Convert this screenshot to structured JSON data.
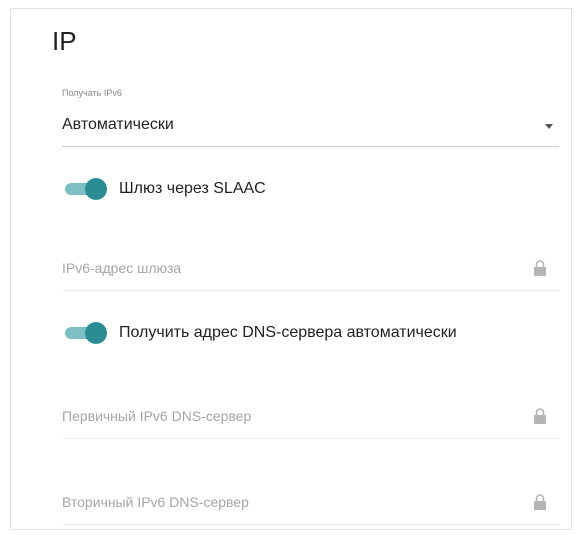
{
  "section": {
    "title": "IP"
  },
  "ipv6_mode": {
    "label": "Получать IPv6",
    "value": "Автоматически"
  },
  "slaac_toggle": {
    "label": "Шлюз через SLAAC",
    "enabled": true
  },
  "gateway_field": {
    "placeholder": "IPv6-адрес шлюза",
    "icon": "lock-icon"
  },
  "dns_auto_toggle": {
    "label": "Получить адрес DNS-сервера автоматически",
    "enabled": true
  },
  "primary_dns_field": {
    "placeholder": "Первичный IPv6 DNS-сервер",
    "icon": "lock-icon"
  },
  "secondary_dns_field": {
    "placeholder": "Вторичный IPv6 DNS-сервер",
    "icon": "lock-icon"
  },
  "colors": {
    "accent": "#2b8c93",
    "accent_light": "#7cc0c4"
  }
}
